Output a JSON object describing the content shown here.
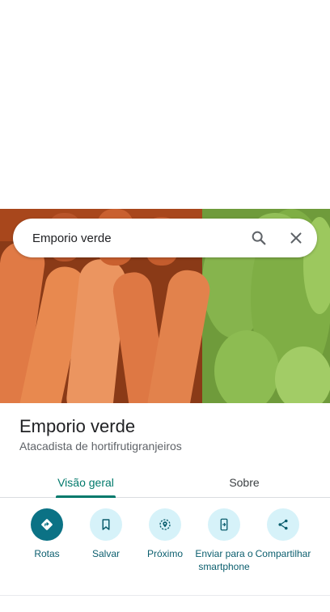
{
  "search": {
    "query": "Emporio verde",
    "search_icon": "search-icon",
    "close_icon": "close-icon"
  },
  "hero": {
    "image_description_icon": "vegetables-photo"
  },
  "place": {
    "title": "Emporio verde",
    "subtitle": "Atacadista de hortifrutigranjeiros"
  },
  "tabs": [
    {
      "label": "Visão geral",
      "selected": true
    },
    {
      "label": "Sobre",
      "selected": false
    }
  ],
  "actions": [
    {
      "label": "Rotas",
      "icon": "directions-icon"
    },
    {
      "label": "Salvar",
      "icon": "bookmark-icon"
    },
    {
      "label": "Próximo",
      "icon": "nearby-icon"
    },
    {
      "label": "Enviar para o smartphone",
      "icon": "send-to-phone-icon"
    },
    {
      "label": "Compartilhar",
      "icon": "share-icon"
    }
  ],
  "colors": {
    "accent": "#00796b",
    "action_bg": "#d6f2f9",
    "primary_action": "#0b7285"
  }
}
